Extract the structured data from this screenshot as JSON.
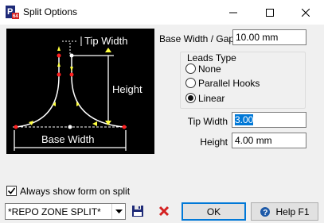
{
  "window": {
    "title": "Split Options",
    "app_icon": "p64-app-icon",
    "controls": [
      "minimize-icon",
      "maximize-icon",
      "close-icon"
    ]
  },
  "preview": {
    "tip_width_label": "Tip Width",
    "height_label": "Height",
    "base_width_label": "Base Width"
  },
  "fields": {
    "base_width_gap": {
      "label": "Base Width / Gap",
      "value": "10.00 mm"
    },
    "tip_width": {
      "label": "Tip Width",
      "value": "3.00"
    },
    "height": {
      "label": "Height",
      "value": "4.00 mm"
    }
  },
  "leads_type": {
    "title": "Leads Type",
    "options": [
      {
        "label": "None",
        "selected": false
      },
      {
        "label": "Parallel Hooks",
        "selected": false
      },
      {
        "label": "Linear",
        "selected": true
      }
    ]
  },
  "always_show": {
    "label": "Always show form on split",
    "checked": true
  },
  "preset": {
    "value": "*REPO ZONE SPLIT*"
  },
  "buttons": {
    "ok": "OK",
    "help": "Help F1",
    "save_icon": "floppy-disk-icon",
    "delete_icon": "red-x-delete-icon"
  },
  "colors": {
    "accent": "#0078d7",
    "preview_bg": "#000000",
    "preview_line": "#ffffff",
    "preview_node": "#ff2020",
    "preview_arrow": "#ffff40",
    "delete_red": "#d42020",
    "floppy_navy": "#1e2a78"
  }
}
